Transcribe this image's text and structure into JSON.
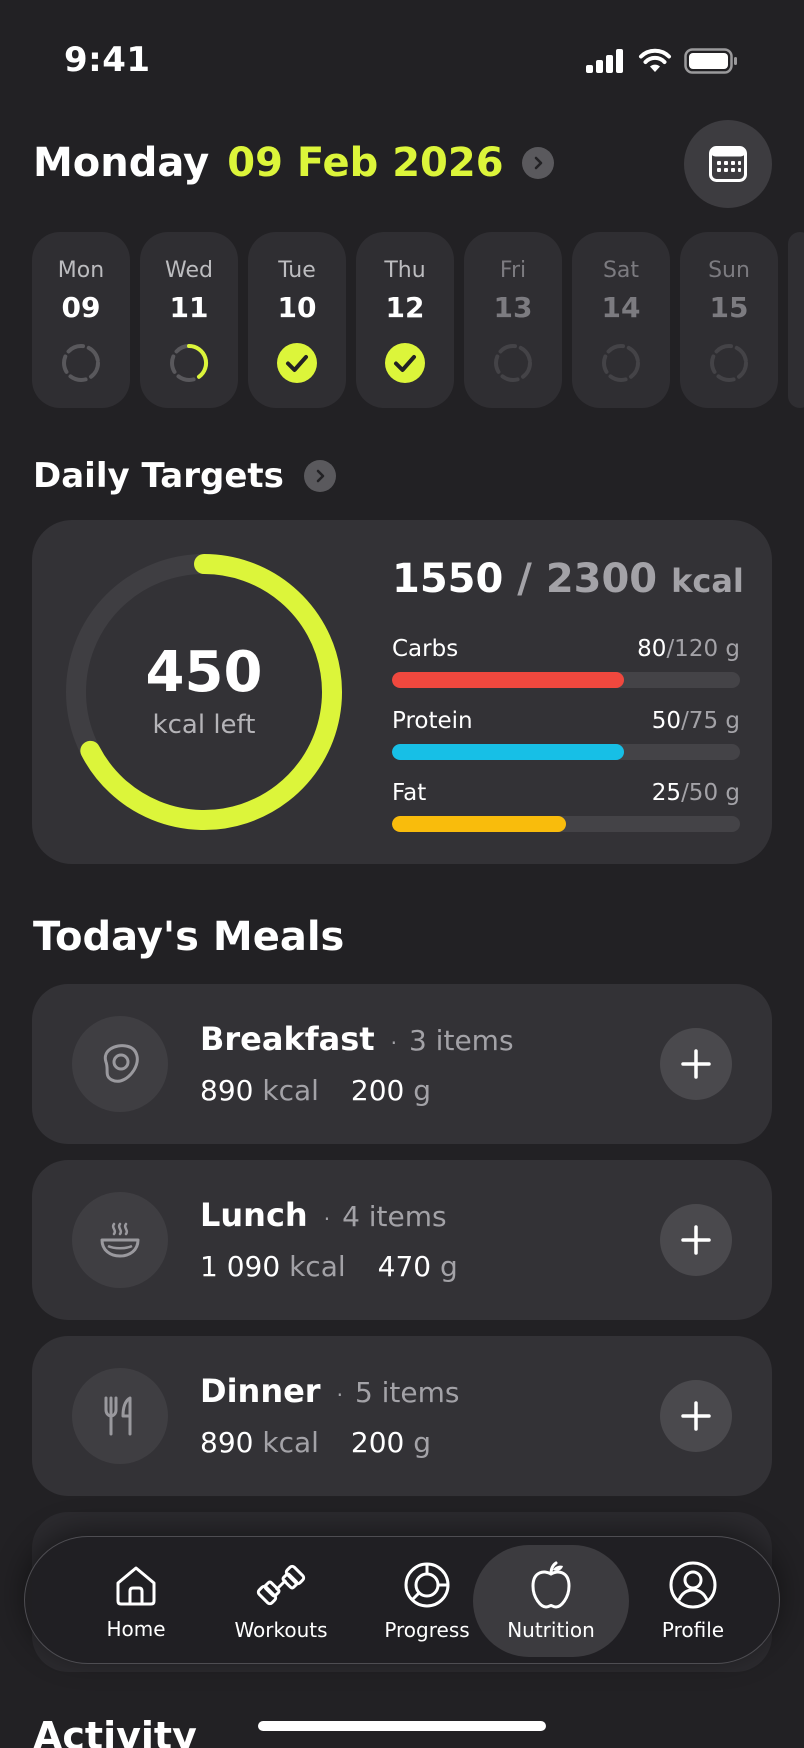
{
  "status": {
    "time": "9:41"
  },
  "header": {
    "day": "Monday",
    "date": "09 Feb 2026"
  },
  "days": [
    {
      "name": "Mon",
      "num": "09",
      "state": "empty"
    },
    {
      "name": "Wed",
      "num": "11",
      "state": "partial"
    },
    {
      "name": "Tue",
      "num": "10",
      "state": "done"
    },
    {
      "name": "Thu",
      "num": "12",
      "state": "done"
    },
    {
      "name": "Fri",
      "num": "13",
      "state": "future"
    },
    {
      "name": "Sat",
      "num": "14",
      "state": "future"
    },
    {
      "name": "Sun",
      "num": "15",
      "state": "future"
    }
  ],
  "targets": {
    "title": "Daily Targets",
    "kcal_left": "450",
    "kcal_left_label": "kcal left",
    "ring_progress": 0.674,
    "consumed": "1550",
    "separator": "/",
    "goal": "2300",
    "unit": "kcal",
    "macros": [
      {
        "name": "Carbs",
        "value": "80",
        "target": "/120 g",
        "progress": 0.667,
        "color": "#f0483e"
      },
      {
        "name": "Protein",
        "value": "50",
        "target": "/75 g",
        "progress": 0.667,
        "color": "#17bfe6"
      },
      {
        "name": "Fat",
        "value": "25",
        "target": "/50 g",
        "progress": 0.5,
        "color": "#f9bc0c"
      }
    ]
  },
  "meals": {
    "title": "Today's Meals",
    "items": [
      {
        "name": "Breakfast",
        "dot": "·",
        "count": "3 items",
        "kcal": "890",
        "kcal_unit": "kcal",
        "grams": "200",
        "grams_unit": "g",
        "icon": "egg-icon"
      },
      {
        "name": "Lunch",
        "dot": "·",
        "count": "4 items",
        "kcal": "1 090",
        "kcal_unit": "kcal",
        "grams": "470",
        "grams_unit": "g",
        "icon": "bowl-icon"
      },
      {
        "name": "Dinner",
        "dot": "·",
        "count": "5 items",
        "kcal": "890",
        "kcal_unit": "kcal",
        "grams": "200",
        "grams_unit": "g",
        "icon": "cutlery-icon"
      }
    ]
  },
  "nav": {
    "items": [
      {
        "label": "Home",
        "icon": "home-icon"
      },
      {
        "label": "Workouts",
        "icon": "dumbbell-icon"
      },
      {
        "label": "Progress",
        "icon": "progress-icon"
      },
      {
        "label": "Nutrition",
        "icon": "apple-icon",
        "active": true
      },
      {
        "label": "Profile",
        "icon": "profile-icon"
      }
    ]
  },
  "activity": {
    "title": "Activity"
  },
  "colors": {
    "accent": "#dcf53a",
    "background": "#222124",
    "card": "#333236"
  }
}
